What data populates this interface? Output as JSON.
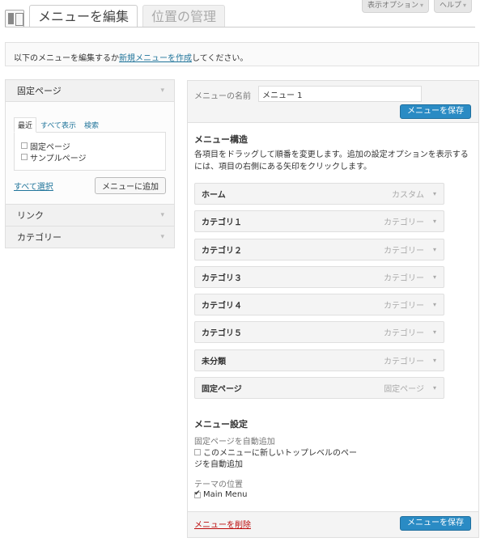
{
  "screen_options": {
    "display_options": "表示オプション",
    "help": "ヘルプ",
    "arrow": "▾"
  },
  "tabs": {
    "edit_menus": "メニューを編集",
    "manage_locations": "位置の管理"
  },
  "notice": {
    "prefix": "以下のメニューを編集するか",
    "link": "新規メニューを作成",
    "suffix": "してください。"
  },
  "left": {
    "pages_title": "固定ページ",
    "inner_tabs": [
      "最近",
      "すべて表示",
      "検索"
    ],
    "checklist": [
      "固定ページ",
      "サンプルページ"
    ],
    "select_all": "すべて選択",
    "add_to_menu": "メニューに追加",
    "links_title": "リンク",
    "categories_title": "カテゴリー",
    "arrow": "▾"
  },
  "right": {
    "name_label": "メニューの名前",
    "name_value": "メニュー 1",
    "save_label": "メニューを保存",
    "structure_title": "メニュー構造",
    "structure_desc": "各項目をドラッグして順番を変更します。追加の設定オプションを表示するには、項目の右側にある矢印をクリックします。",
    "items": [
      {
        "label": "ホーム",
        "type": "カスタム"
      },
      {
        "label": "カテゴリ１",
        "type": "カテゴリー"
      },
      {
        "label": "カテゴリ２",
        "type": "カテゴリー"
      },
      {
        "label": "カテゴリ３",
        "type": "カテゴリー"
      },
      {
        "label": "カテゴリ４",
        "type": "カテゴリー"
      },
      {
        "label": "カテゴリ５",
        "type": "カテゴリー"
      },
      {
        "label": "未分類",
        "type": "カテゴリー"
      },
      {
        "label": "固定ページ",
        "type": "固定ページ"
      }
    ],
    "item_arrow": "▾",
    "settings_title": "メニュー設定",
    "auto_add_label": "固定ページを自動追加",
    "auto_add_text": "このメニューに新しいトップレベルのページを自動追加",
    "theme_loc_label": "テーマの位置",
    "theme_loc_value": "Main Menu",
    "delete_label": "メニューを削除"
  },
  "colors": {
    "primary_button": "#2a8bc4",
    "link": "#21759b",
    "delete": "#bc0b0b"
  }
}
